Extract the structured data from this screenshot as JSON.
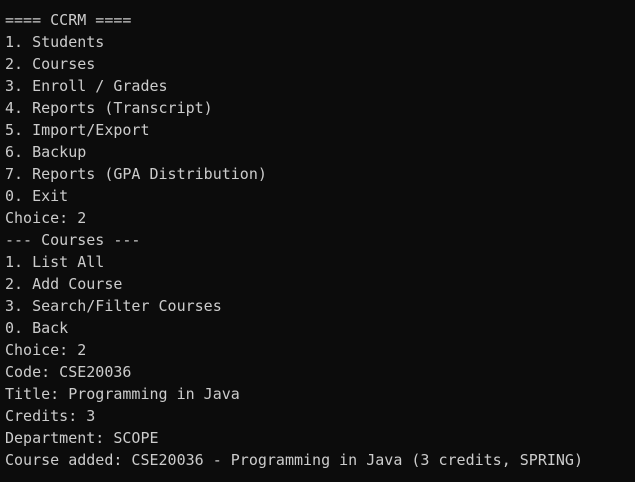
{
  "terminal": {
    "lines": [
      "==== CCRM ====",
      "1. Students",
      "2. Courses",
      "3. Enroll / Grades",
      "4. Reports (Transcript)",
      "5. Import/Export",
      "6. Backup",
      "7. Reports (GPA Distribution)",
      "0. Exit",
      "Choice: 2",
      "--- Courses ---",
      "1. List All",
      "2. Add Course",
      "3. Search/Filter Courses",
      "0. Back",
      "Choice: 2",
      "Code: CSE20036",
      "Title: Programming in Java",
      "Credits: 3",
      "Department: SCOPE",
      "Course added: CSE20036 - Programming in Java (3 credits, SPRING)"
    ],
    "colors": {
      "background": "#0c0c0c",
      "text": "#cccccc"
    }
  }
}
